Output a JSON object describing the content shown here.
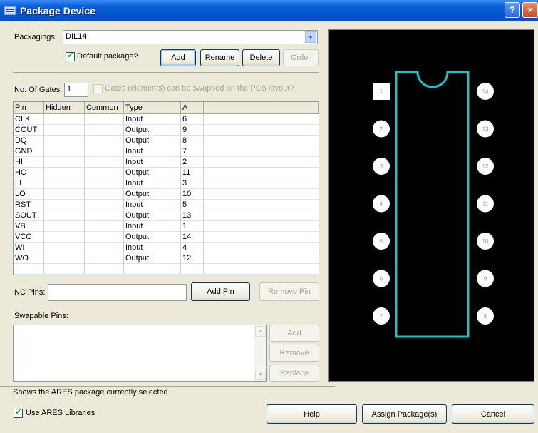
{
  "window": {
    "title": "Package Device"
  },
  "packagings": {
    "label": "Packagings:",
    "value": "DIL14"
  },
  "default_package": {
    "label": "Default package?",
    "checked": true
  },
  "buttons": {
    "add": "Add",
    "rename": "Rename",
    "delete": "Delete",
    "order": "Order"
  },
  "gates": {
    "label": "No. Of Gates:",
    "value": "1",
    "swap_label": "Gates (elements) can be swapped on the PCB layout?"
  },
  "pin_table": {
    "headers": [
      "Pin",
      "Hidden",
      "Common",
      "Type",
      "A"
    ],
    "rows": [
      [
        "CLK",
        "",
        "",
        "Input",
        "6"
      ],
      [
        "COUT",
        "",
        "",
        "Output",
        "9"
      ],
      [
        "DQ",
        "",
        "",
        "Output",
        "8"
      ],
      [
        "GND",
        "",
        "",
        "Input",
        "7"
      ],
      [
        "HI",
        "",
        "",
        "Input",
        "2"
      ],
      [
        "HO",
        "",
        "",
        "Output",
        "11"
      ],
      [
        "LI",
        "",
        "",
        "Input",
        "3"
      ],
      [
        "LO",
        "",
        "",
        "Output",
        "10"
      ],
      [
        "RST",
        "",
        "",
        "Input",
        "5"
      ],
      [
        "SOUT",
        "",
        "",
        "Output",
        "13"
      ],
      [
        "VB",
        "",
        "",
        "Input",
        "1"
      ],
      [
        "VCC",
        "",
        "",
        "Output",
        "14"
      ],
      [
        "WI",
        "",
        "",
        "Input",
        "4"
      ],
      [
        "WO",
        "",
        "",
        "Output",
        "12"
      ]
    ]
  },
  "nc_pins": {
    "label": "NC Pins:",
    "value": "",
    "add_pin": "Add Pin",
    "remove_pin": "Remove Pin"
  },
  "swappable": {
    "label": "Swapable Pins:",
    "add": "Add",
    "remove": "Remove",
    "replace": "Replace"
  },
  "status_text": "Shows the ARES package currently selected",
  "use_ares": {
    "label": "Use ARES Libraries",
    "checked": true
  },
  "footer": {
    "help": "Help",
    "assign": "Assign Package(s)",
    "cancel": "Cancel"
  },
  "preview": {
    "left_pins": [
      "1",
      "2",
      "3",
      "4",
      "5",
      "6",
      "7"
    ],
    "right_pins": [
      "14",
      "13",
      "12",
      "11",
      "10",
      "9",
      "8"
    ],
    "outline_color": "#19c6c6",
    "pad_color": "#ffffff"
  }
}
